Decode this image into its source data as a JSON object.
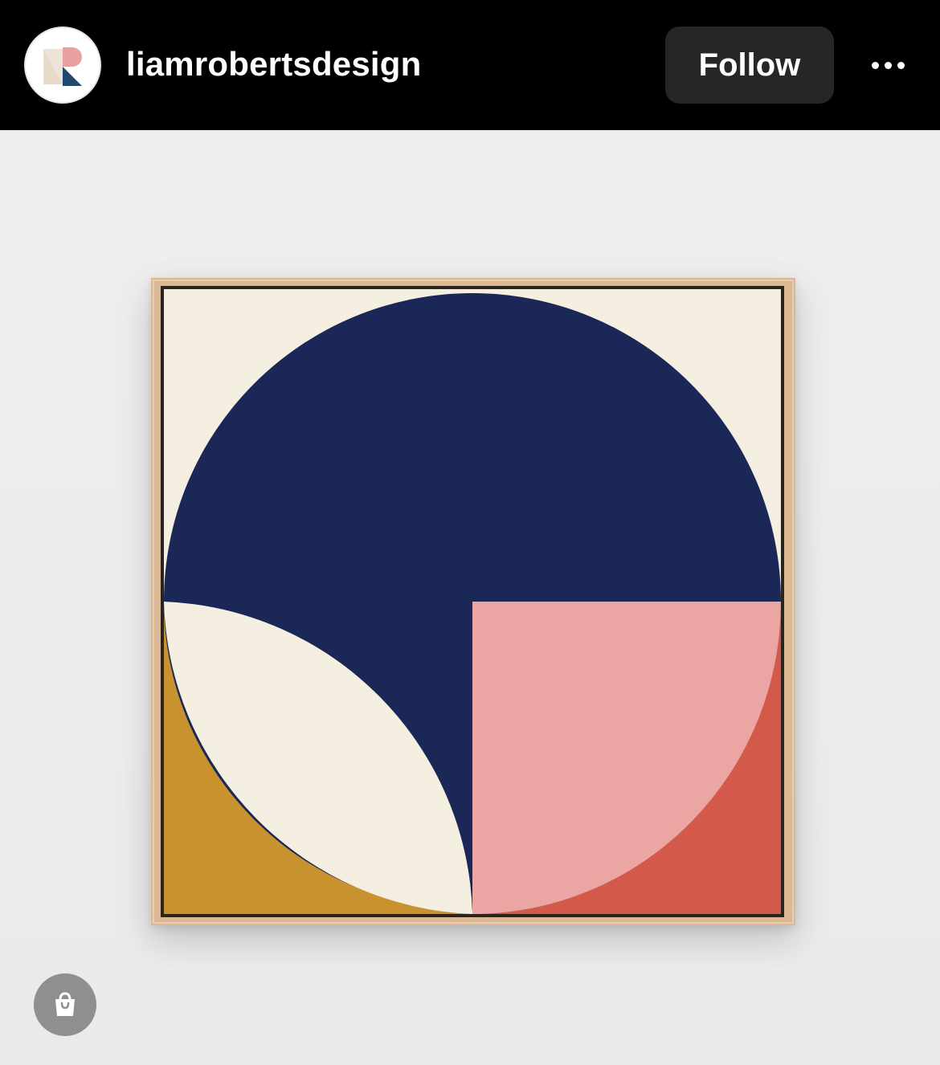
{
  "header": {
    "username": "liamrobertsdesign",
    "follow_label": "Follow",
    "more_icon": "more-horizontal-icon",
    "avatar_icon": "brand-logo-icon"
  },
  "post": {
    "image_subject": "abstract-geometric-painting",
    "shop_icon": "shopping-bag-icon"
  },
  "colors": {
    "header_bg": "#000000",
    "follow_bg": "#262626",
    "background": "#ededed",
    "navy": "#1b2857",
    "cream": "#f4efe0",
    "pink": "#eba6a4",
    "red": "#d35a4a",
    "mustard": "#c8922e",
    "frame": "#dcb794"
  }
}
